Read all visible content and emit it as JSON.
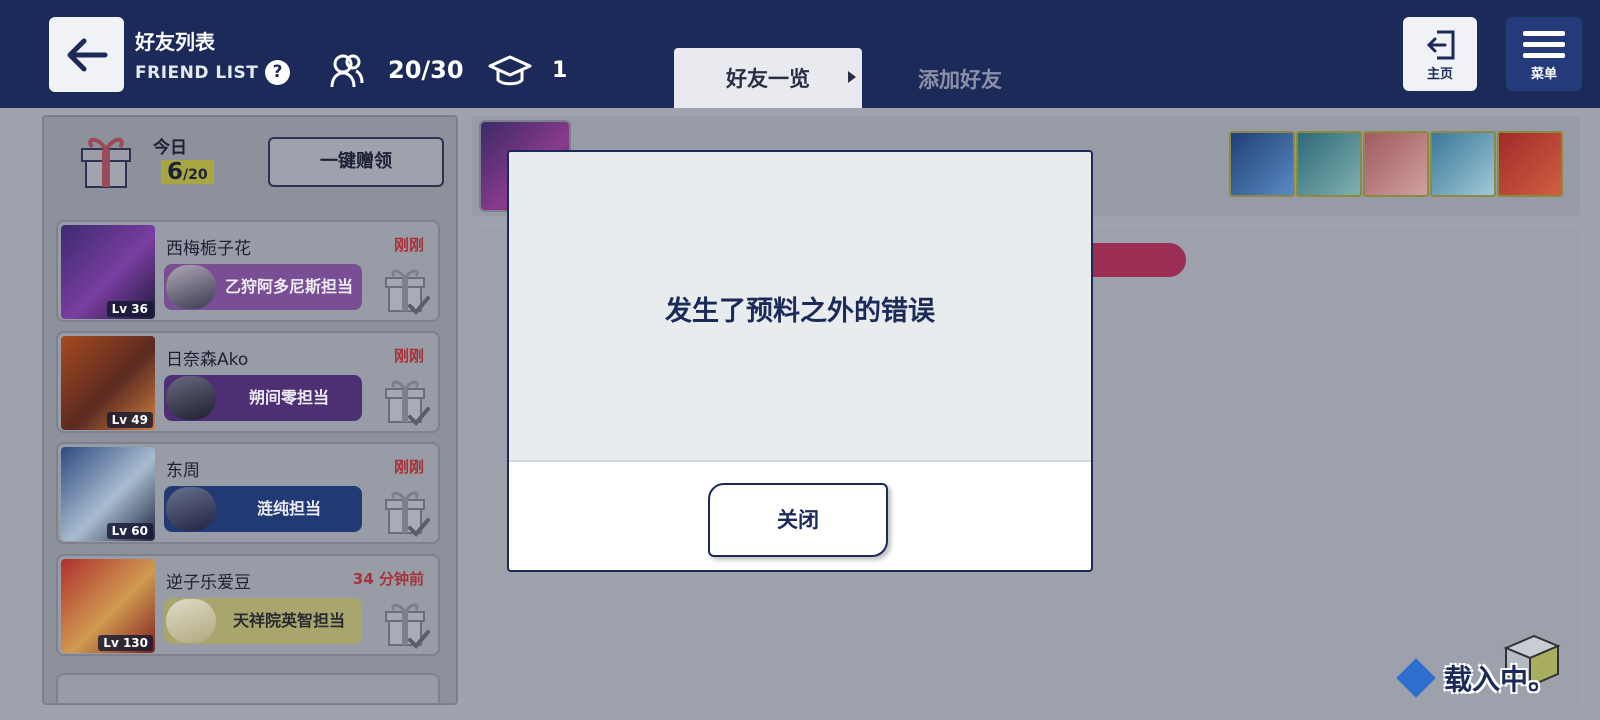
{
  "header": {
    "back_icon": "arrow-left-icon",
    "title_cn": "好友列表",
    "title_en": "FRIEND LIST",
    "help_icon": "question-icon",
    "help_label": "?",
    "friend_count": "20/30",
    "graduate_count": "1",
    "tabs": [
      {
        "label": "好友一览",
        "active": true
      },
      {
        "label": "添加好友",
        "active": false
      }
    ],
    "home_label": "主页",
    "menu_label": "菜单"
  },
  "sidebar": {
    "today_label": "今日",
    "today_count": "6",
    "today_total": "/20",
    "claim_all_label": "一键赠领",
    "friends": [
      {
        "name": "西梅栀子花",
        "time": "刚刚",
        "level": "Lv 36",
        "role": "乙狩阿多尼斯担当",
        "role_color": "#7a4e94",
        "role_text_color": "#ececf2",
        "avatar_colors": [
          "#3c2a70",
          "#7a3ea0",
          "#1e1a3a"
        ],
        "role_icon_colors": [
          "#3a3a50",
          "#b0a8b8"
        ]
      },
      {
        "name": "日奈森Ako",
        "time": "刚刚",
        "level": "Lv 49",
        "role": "朔间零担当",
        "role_color": "#4f2f73",
        "role_text_color": "#ececf2",
        "avatar_colors": [
          "#a84a20",
          "#5a2a20",
          "#d08040"
        ],
        "role_icon_colors": [
          "#1e1e30",
          "#6a6a80"
        ]
      },
      {
        "name": "东周",
        "time": "刚刚",
        "level": "Lv 60",
        "role": "涟纯担当",
        "role_color": "#223a74",
        "role_text_color": "#ececf2",
        "avatar_colors": [
          "#2f4a80",
          "#a8bcd0",
          "#1c2440"
        ],
        "role_icon_colors": [
          "#1e2440",
          "#6a7090"
        ]
      },
      {
        "name": "逆子乐爱豆",
        "time": "34 分钟前",
        "level": "Lv 130",
        "role": "天祥院英智担当",
        "role_color": "#a8a66c",
        "role_text_color": "#2a2a30",
        "avatar_colors": [
          "#b03030",
          "#d09a50",
          "#802020"
        ],
        "role_icon_colors": [
          "#b0a880",
          "#e0dcc8"
        ]
      }
    ]
  },
  "profile": {
    "unit_card_colors": [
      [
        "#1f3f78",
        "#5a8ac0"
      ],
      [
        "#2f6a78",
        "#80b0b0"
      ],
      [
        "#a05a60",
        "#d0a0a0"
      ],
      [
        "#3a7898",
        "#a0c8d8"
      ],
      [
        "#a02a2a",
        "#d06040"
      ]
    ]
  },
  "loading_text": "载入中。",
  "modal": {
    "message": "发生了预料之外的错误",
    "close_label": "关闭"
  }
}
